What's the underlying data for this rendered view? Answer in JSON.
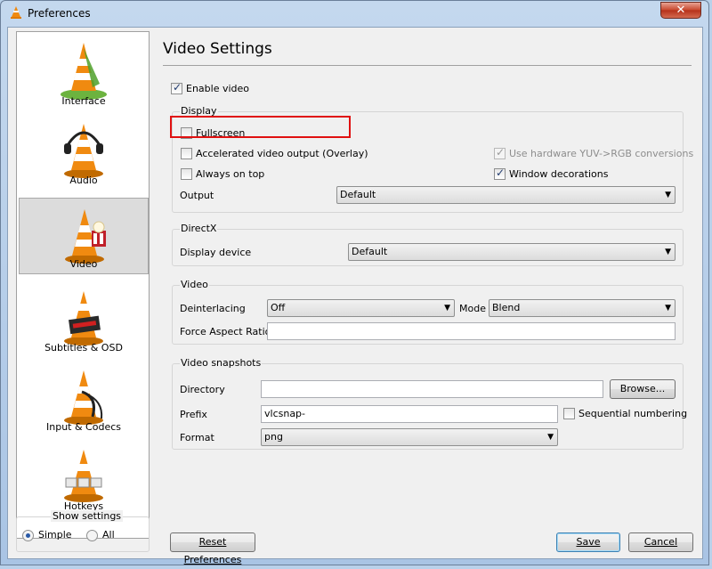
{
  "window": {
    "title": "Preferences",
    "close_label": "✕"
  },
  "sidebar": {
    "items": [
      {
        "label": "Interface",
        "icon": "vlc-cone-interface-icon"
      },
      {
        "label": "Audio",
        "icon": "vlc-cone-headphones-icon"
      },
      {
        "label": "Video",
        "icon": "vlc-cone-video-icon",
        "selected": true
      },
      {
        "label": "Subtitles & OSD",
        "icon": "vlc-cone-subtitles-icon"
      },
      {
        "label": "Input & Codecs",
        "icon": "vlc-cone-input-icon"
      },
      {
        "label": "Hotkeys",
        "icon": "vlc-cone-hotkeys-icon"
      }
    ],
    "show_settings": {
      "title": "Show settings",
      "simple": "Simple",
      "all": "All",
      "selected": "Simple"
    }
  },
  "panel": {
    "title": "Video Settings",
    "enable_video": {
      "label": "Enable video",
      "checked": true
    },
    "display": {
      "title": "Display",
      "fullscreen": {
        "label": "Fullscreen",
        "checked": false
      },
      "overlay": {
        "label": "Accelerated video output (Overlay)",
        "checked": false
      },
      "always_on_top": {
        "label": "Always on top",
        "checked": false
      },
      "yuv": {
        "label": "Use hardware YUV->RGB conversions",
        "checked": true,
        "disabled": true
      },
      "window_decorations": {
        "label": "Window decorations",
        "checked": true
      },
      "output_label": "Output",
      "output_value": "Default"
    },
    "directx": {
      "title": "DirectX",
      "device_label": "Display device",
      "device_value": "Default"
    },
    "video": {
      "title": "Video",
      "deinterlacing_label": "Deinterlacing",
      "deinterlacing_value": "Off",
      "mode_label": "Mode",
      "mode_value": "Blend",
      "aspect_label": "Force Aspect Ratio",
      "aspect_value": ""
    },
    "snapshots": {
      "title": "Video snapshots",
      "directory_label": "Directory",
      "directory_value": "",
      "browse_label": "Browse...",
      "prefix_label": "Prefix",
      "prefix_value": "vlcsnap-",
      "sequential_label": "Sequential numbering",
      "format_label": "Format",
      "format_value": "png"
    }
  },
  "footer": {
    "reset_label": "Reset Preferences",
    "save_label": "Save",
    "cancel_label": "Cancel"
  },
  "colors": {
    "highlight_box": "#e01010",
    "cone_orange": "#f08a10"
  }
}
